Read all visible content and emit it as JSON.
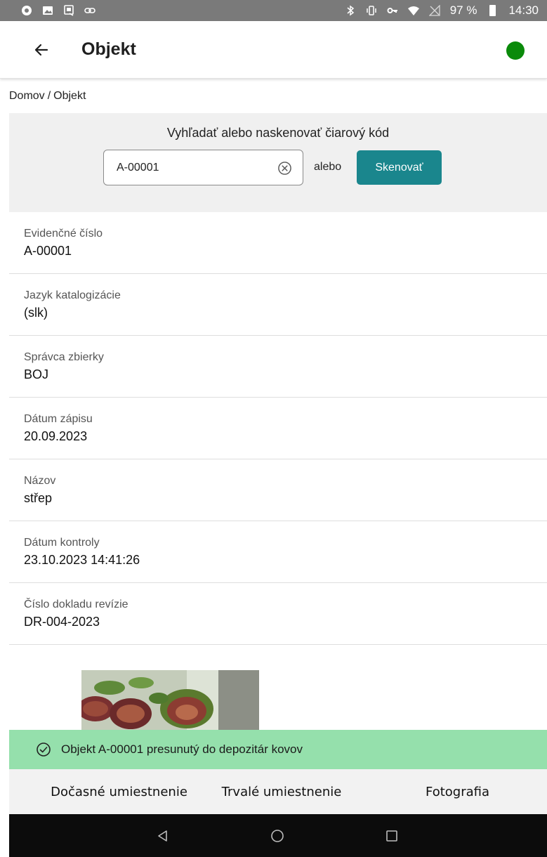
{
  "status_bar": {
    "battery": "97 %",
    "time": "14:30",
    "icons_left": [
      "app-notification-icon",
      "image-icon",
      "screenshot-icon",
      "link-icon"
    ],
    "icons_right": [
      "bluetooth-icon",
      "vibrate-icon",
      "vpn-key-icon",
      "wifi-icon",
      "no-signal-icon",
      "battery-icon"
    ]
  },
  "appbar": {
    "back_icon": "arrow-left-icon",
    "title": "Objekt",
    "status_color": "#0a8a0a"
  },
  "breadcrumb": {
    "home": "Domov",
    "separator": "/",
    "current": "Objekt"
  },
  "search": {
    "label": "Vyhľadať alebo naskenovať čiarový kód",
    "value": "A-00001",
    "or_text": "alebo",
    "scan_label": "Skenovať",
    "accent_color": "#1a868d"
  },
  "fields": [
    {
      "label": "Evidenčné číslo",
      "value": "A-00001"
    },
    {
      "label": "Jazyk katalogizácie",
      "value": "(slk)"
    },
    {
      "label": "Správca zbierky",
      "value": "BOJ"
    },
    {
      "label": "Dátum zápisu",
      "value": "20.09.2023"
    },
    {
      "label": "Názov",
      "value": "střep"
    },
    {
      "label": "Dátum kontroly",
      "value": "23.10.2023 14:41:26"
    },
    {
      "label": "Číslo dokladu revízie",
      "value": "DR-004-2023"
    }
  ],
  "toast": {
    "icon": "check-circle-icon",
    "message": "Objekt A-00001 presunutý do depozitár kovov",
    "color": "#95e0ac"
  },
  "tabs": [
    {
      "label": "Dočasné umiestnenie"
    },
    {
      "label": "Trvalé umiestnenie"
    },
    {
      "label": "Fotografia"
    }
  ],
  "navbar": {
    "back_icon": "nav-back-icon",
    "home_icon": "nav-home-icon",
    "recents_icon": "nav-recents-icon"
  }
}
